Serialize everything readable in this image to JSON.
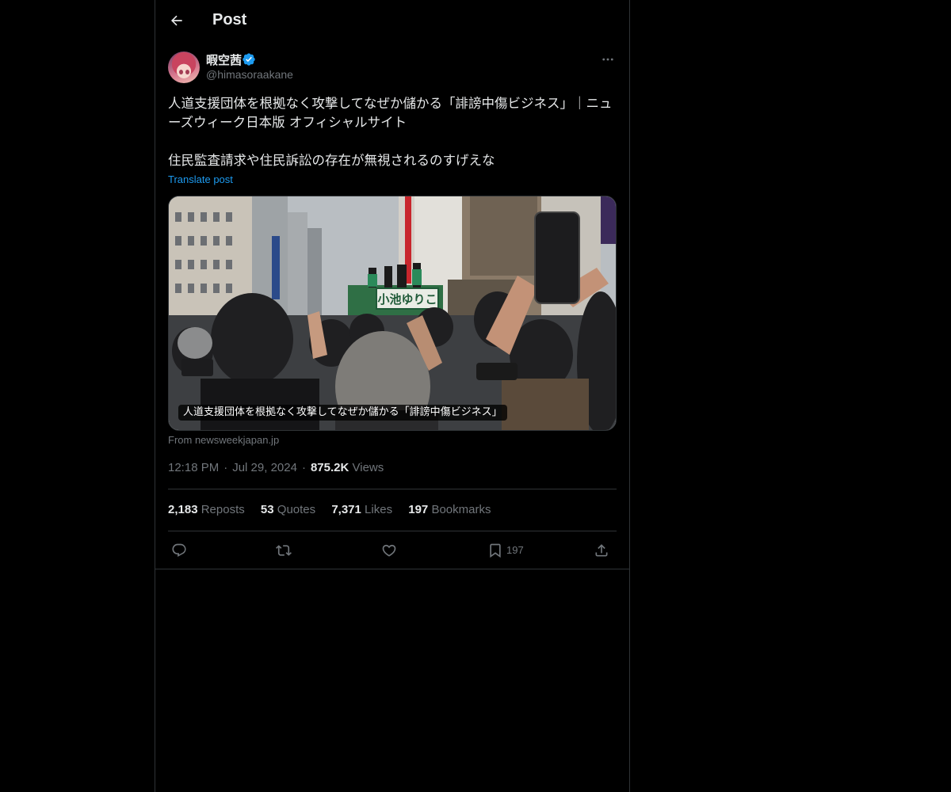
{
  "header": {
    "title": "Post"
  },
  "author": {
    "display_name": "暇空茜",
    "handle": "@himasoraakane",
    "verified": true
  },
  "post": {
    "text": "人道支援団体を根拠なく攻撃してなぜか儲かる「誹謗中傷ビジネス」｜ニューズウィーク日本版 オフィシャルサイト\n\n住民監査請求や住民訴訟の存在が無視されるのすげえな",
    "translate_label": "Translate post"
  },
  "media": {
    "caption": "人道支援団体を根拠なく攻撃してなぜか儲かる「誹謗中傷ビジネス」",
    "sign_text": "小池ゆりこ",
    "source": "From newsweekjapan.jp"
  },
  "meta": {
    "time": "12:18 PM",
    "date": "Jul 29, 2024",
    "views_value": "875.2K",
    "views_label": "Views"
  },
  "stats": {
    "reposts_value": "2,183",
    "reposts_label": "Reposts",
    "quotes_value": "53",
    "quotes_label": "Quotes",
    "likes_value": "7,371",
    "likes_label": "Likes",
    "bookmarks_value": "197",
    "bookmarks_label": "Bookmarks"
  },
  "actions": {
    "icons": [
      "reply-icon",
      "repost-icon",
      "like-icon",
      "bookmark-icon",
      "share-icon"
    ],
    "bookmark_count": "197"
  },
  "colors": {
    "background": "#000000",
    "text": "#e7e9ea",
    "muted": "#71767b",
    "accent": "#1d9bf0",
    "border": "#2f3336"
  }
}
